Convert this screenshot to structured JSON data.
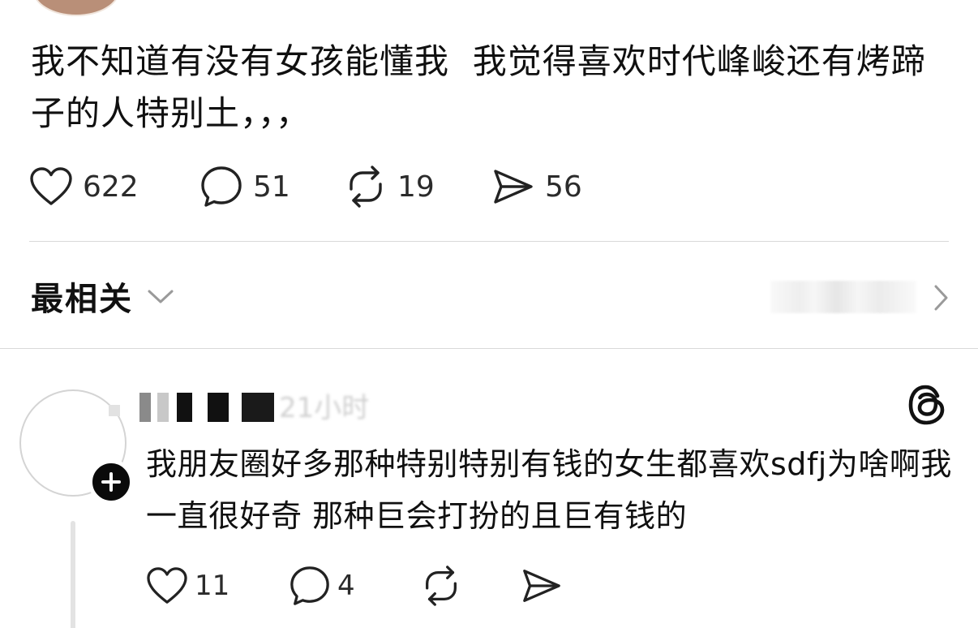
{
  "post": {
    "text": "我不知道有没有女孩能懂我  我觉得喜欢时代峰峻还有烤蹄子的人特别土，，，",
    "likes": "622",
    "comments": "51",
    "reposts": "19",
    "shares": "56"
  },
  "sort": {
    "label": "最相关"
  },
  "reply": {
    "time": "21小时",
    "text": "我朋友圈好多那种特别特别有钱的女生都喜欢sdfj为啥啊我一直很好奇 那种巨会打扮的且巨有钱的",
    "likes": "11",
    "comments": "4"
  },
  "icons": {
    "like": "heart-icon",
    "comment": "comment-bubble-icon",
    "repost": "repost-icon",
    "share": "send-icon",
    "sort_dropdown": "chevron-down-icon",
    "activity": "chevron-right-icon",
    "follow": "plus-icon",
    "app_logo": "threads-logo-icon"
  }
}
